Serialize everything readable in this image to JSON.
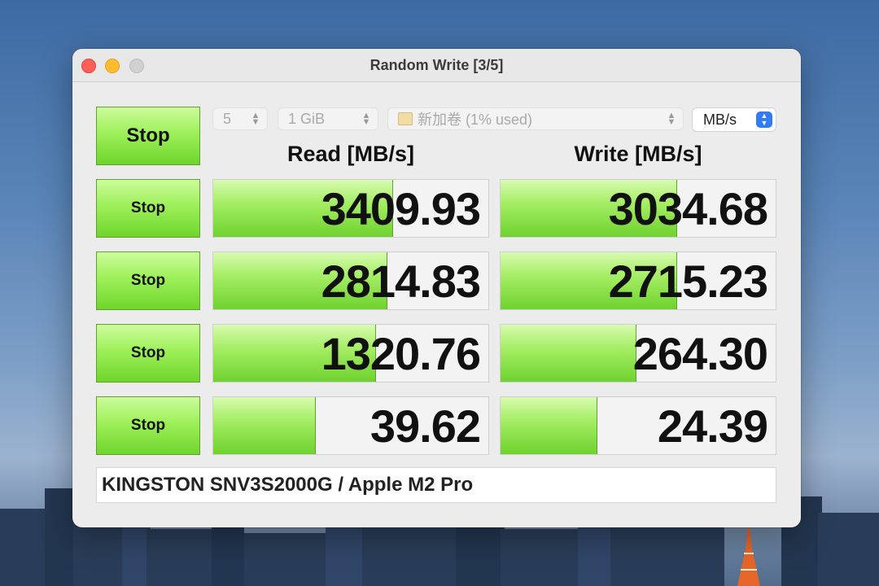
{
  "window": {
    "title": "Random Write [3/5]"
  },
  "controls": {
    "main_button": "Stop",
    "count": "5",
    "size": "1 GiB",
    "volume": "新加卷 (1% used)",
    "unit": "MB/s"
  },
  "columns": {
    "read": "Read [MB/s]",
    "write": "Write [MB/s]"
  },
  "rows": [
    {
      "button": "Stop",
      "read": "3409.93",
      "write": "3034.68",
      "read_fill": 0.65,
      "write_fill": 0.64
    },
    {
      "button": "Stop",
      "read": "2814.83",
      "write": "2715.23",
      "read_fill": 0.63,
      "write_fill": 0.64
    },
    {
      "button": "Stop",
      "read": "1320.76",
      "write": "264.30",
      "read_fill": 0.59,
      "write_fill": 0.49
    },
    {
      "button": "Stop",
      "read": "39.62",
      "write": "24.39",
      "read_fill": 0.37,
      "write_fill": 0.35
    }
  ],
  "footer": {
    "device": "KINGSTON SNV3S2000G / Apple M2 Pro"
  },
  "colors": {
    "accent_green": "#8ee34c",
    "unit_selector_blue": "#2f7cf6"
  }
}
